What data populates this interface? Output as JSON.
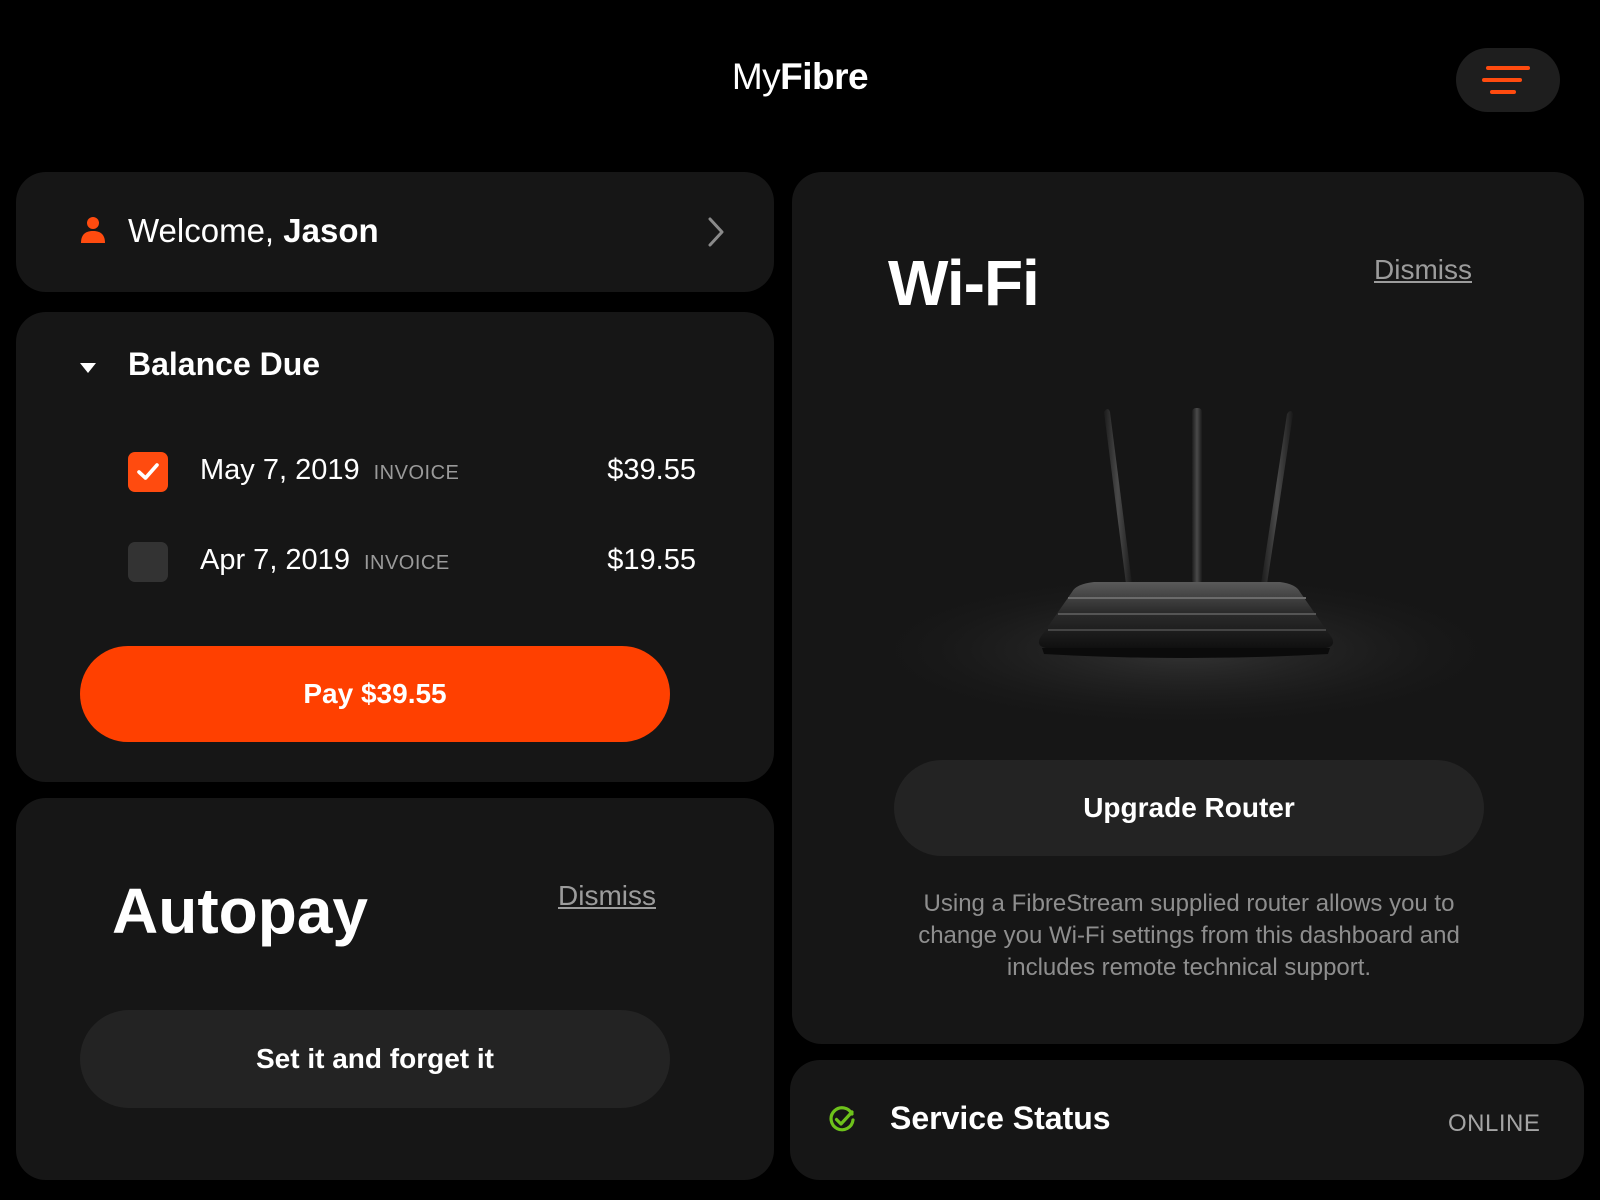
{
  "header": {
    "brand_prefix": "My",
    "brand_bold": "Fibre",
    "menu_icon": "hamburger-menu-icon",
    "accent_color": "#ff4b0f"
  },
  "welcome": {
    "greeting": "Welcome,",
    "name": "Jason",
    "icon": "person-icon"
  },
  "balance": {
    "title": "Balance Due",
    "invoices": [
      {
        "date": "May 7, 2019",
        "tag": "INVOICE",
        "amount": "$39.55",
        "checked": true
      },
      {
        "date": "Apr 7, 2019",
        "tag": "INVOICE",
        "amount": "$19.55",
        "checked": false
      }
    ],
    "pay_label": "Pay $39.55"
  },
  "autopay": {
    "title": "Autopay",
    "dismiss_label": "Dismiss",
    "button_label": "Set it and forget it"
  },
  "wifi": {
    "title": "Wi-Fi",
    "dismiss_label": "Dismiss",
    "button_label": "Upgrade Router",
    "description": "Using a FibreStream supplied router allows you to change you Wi-Fi settings from this dashboard and includes remote technical support."
  },
  "service_status": {
    "label": "Service Status",
    "state": "ONLINE",
    "icon": "check-circle-icon",
    "status_color": "#6ec21b"
  }
}
